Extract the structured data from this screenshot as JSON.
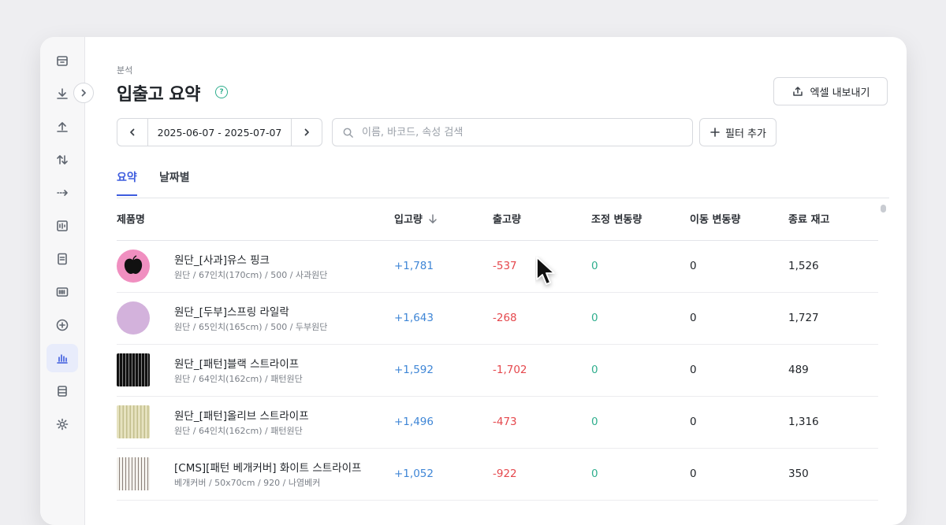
{
  "header": {
    "breadcrumb": "분석",
    "title": "입출고 요약",
    "help": "?",
    "export_label": "엑셀 내보내기"
  },
  "toolbar": {
    "date_range": "2025-06-07 - 2025-07-07",
    "search_placeholder": "이름, 바코드, 속성 검색",
    "filter_label": "필터 추가"
  },
  "tabs": [
    {
      "label": "요약",
      "active": true
    },
    {
      "label": "날짜별",
      "active": false
    }
  ],
  "table": {
    "columns": [
      "제품명",
      "입고량",
      "출고량",
      "조정 변동량",
      "이동 변동량",
      "종료 재고"
    ],
    "rows": [
      {
        "name": "원단_[사과]유스 핑크",
        "desc": "원단 / 67인치(170cm) / 500 / 사과원단",
        "in": "+1,781",
        "out": "-537",
        "adj": "0",
        "mov": "0",
        "end": "1,526",
        "thumb": "apple-pink"
      },
      {
        "name": "원단_[두부]스프링 라일락",
        "desc": "원단 / 65인치(165cm) / 500 / 두부원단",
        "in": "+1,643",
        "out": "-268",
        "adj": "0",
        "mov": "0",
        "end": "1,727",
        "thumb": "lilac-circle"
      },
      {
        "name": "원단_[패턴]블랙 스트라이프",
        "desc": "원단 / 64인치(162cm) / 패턴원단",
        "in": "+1,592",
        "out": "-1,702",
        "adj": "0",
        "mov": "0",
        "end": "489",
        "thumb": "black-stripe"
      },
      {
        "name": "원단_[패턴]올리브 스트라이프",
        "desc": "원단 / 64인치(162cm) / 패턴원단",
        "in": "+1,496",
        "out": "-473",
        "adj": "0",
        "mov": "0",
        "end": "1,316",
        "thumb": "olive-stripe"
      },
      {
        "name": "[CMS][패턴 베개커버] 화이트 스트라이프",
        "desc": "베개커버 / 50x70cm / 920 / 나염베커",
        "in": "+1,052",
        "out": "-922",
        "adj": "0",
        "mov": "0",
        "end": "350",
        "thumb": "white-stripe"
      }
    ]
  },
  "colors": {
    "accent": "#3d5cde",
    "in": "#3f86d6",
    "out": "#e5484d",
    "adj": "#2fae8d"
  },
  "sidebar_icons": [
    "box-icon",
    "download-icon",
    "upload-icon",
    "transfer-icon",
    "move-icon",
    "stats-card-icon",
    "document-icon",
    "barcode-icon",
    "add-circle-icon",
    "bar-chart-icon",
    "database-icon",
    "gear-icon"
  ]
}
